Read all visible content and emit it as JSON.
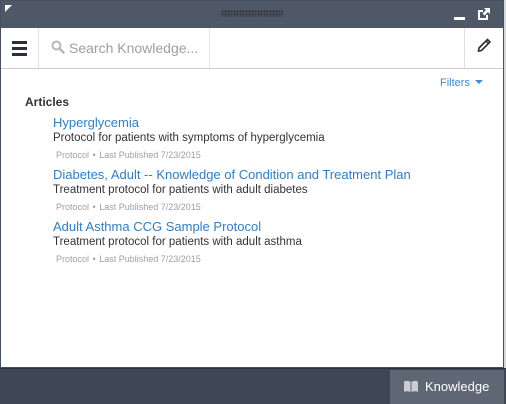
{
  "search": {
    "placeholder": "Search Knowledge..."
  },
  "filters": {
    "label": "Filters"
  },
  "section": {
    "heading": "Articles"
  },
  "articles": [
    {
      "title": "Hyperglycemia",
      "description": "Protocol for patients with symptoms of hyperglycemia",
      "type": "Protocol",
      "published": "Last Published 7/23/2015"
    },
    {
      "title": "Diabetes, Adult -- Knowledge of Condition and Treatment Plan",
      "description": "Treatment protocol for patients with adult diabetes",
      "type": "Protocol",
      "published": "Last Published 7/23/2015"
    },
    {
      "title": "Adult Asthma CCG Sample Protocol",
      "description": "Treatment protocol for patients with adult asthma",
      "type": "Protocol",
      "published": "Last Published 7/23/2015"
    }
  ],
  "bottom_tab": {
    "label": "Knowledge",
    "icon": "book-icon"
  },
  "colors": {
    "titlebar": "#4f5866",
    "link": "#2e7fc6",
    "bottom_bar": "#3f4756",
    "active_tab": "#5f6775"
  }
}
